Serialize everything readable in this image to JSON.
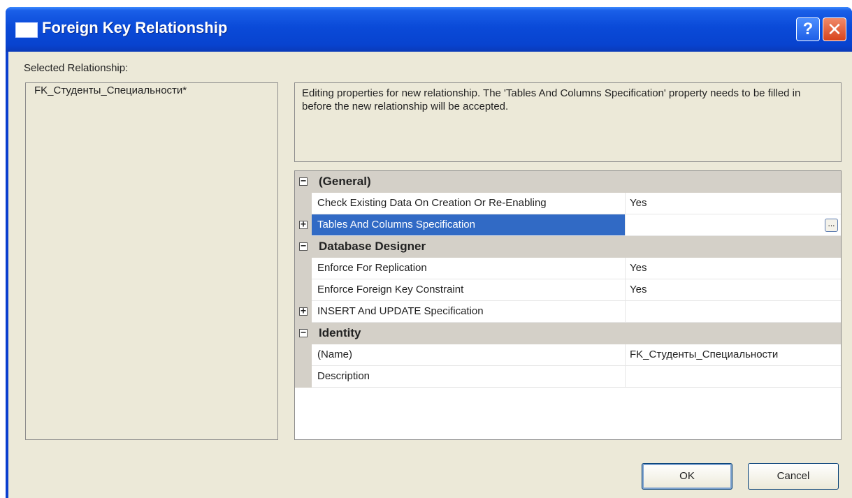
{
  "window": {
    "title": "Foreign Key Relationship",
    "help_label": "?",
    "close_label": "✕",
    "titlebar_color": "#0843cf"
  },
  "left": {
    "label": "Selected Relationship:",
    "items": [
      "FK_Студенты_Специальности*"
    ]
  },
  "description": "Editing properties for new relationship.  The 'Tables And Columns Specification' property needs to be filled in before the new relationship will be accepted.",
  "grid": {
    "categories": [
      {
        "label": "(General)",
        "toggle": "−",
        "props": [
          {
            "name": "Check Existing Data On Creation Or Re-Enabling",
            "value": "Yes"
          },
          {
            "name": "Tables And Columns Specification",
            "value": "",
            "toggle": "+",
            "selected": true,
            "ellipsis": "..."
          }
        ]
      },
      {
        "label": "Database Designer",
        "toggle": "−",
        "props": [
          {
            "name": "Enforce For Replication",
            "value": "Yes"
          },
          {
            "name": "Enforce Foreign Key Constraint",
            "value": "Yes"
          },
          {
            "name": "INSERT And UPDATE Specification",
            "value": "",
            "toggle": "+"
          }
        ]
      },
      {
        "label": "Identity",
        "toggle": "−",
        "props": [
          {
            "name": "(Name)",
            "value": "FK_Студенты_Специальности"
          },
          {
            "name": "Description",
            "value": ""
          }
        ]
      }
    ]
  },
  "buttons": {
    "ok": "OK",
    "cancel": "Cancel"
  },
  "colors": {
    "selection": "#316ac5",
    "dialog_bg": "#ece9d8"
  }
}
